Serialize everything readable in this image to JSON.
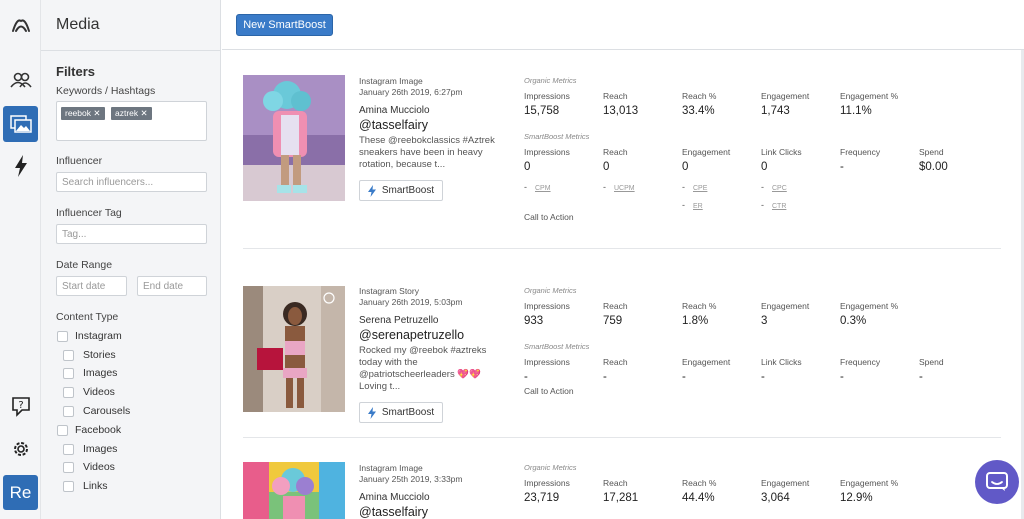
{
  "brand": {
    "logo_icon": "logo-icon",
    "accent": "#2f6db5"
  },
  "rail": {
    "items": [
      {
        "name": "influencers-icon"
      },
      {
        "name": "media-icon",
        "active": true
      },
      {
        "name": "boost-icon"
      },
      {
        "name": "help-icon"
      },
      {
        "name": "settings-icon"
      }
    ],
    "account_label": "Re"
  },
  "sidebar": {
    "title": "Media",
    "filters_heading": "Filters",
    "keywords_label": "Keywords / Hashtags",
    "tags": [
      "reebok",
      "aztrek"
    ],
    "influencer_label": "Influencer",
    "influencer_placeholder": "Search influencers...",
    "influencer_tag_label": "Influencer Tag",
    "tag_placeholder": "Tag...",
    "date_range_label": "Date Range",
    "start_placeholder": "Start date",
    "end_placeholder": "End date",
    "content_type_label": "Content Type",
    "content_types": {
      "instagram": "Instagram",
      "stories": "Stories",
      "images": "Images",
      "videos": "Videos",
      "carousels": "Carousels",
      "facebook": "Facebook",
      "fb_images": "Images",
      "fb_videos": "Videos",
      "fb_links": "Links"
    }
  },
  "toolbar": {
    "new_smartboost": "New SmartBoost"
  },
  "posts": [
    {
      "type": "Instagram Image",
      "date": "January 26th 2019, 6:27pm",
      "name": "Amina Mucciolo",
      "handle": "@tasselfairy",
      "caption": "These @reebokclassics #Aztrek sneakers have been in heavy rotation, because t...",
      "smartboost_label": "SmartBoost",
      "organic_label": "Organic Metrics",
      "organic": [
        {
          "label": "Impressions",
          "value": "15,758"
        },
        {
          "label": "Reach",
          "value": "13,013"
        },
        {
          "label": "Reach %",
          "value": "33.4%"
        },
        {
          "label": "Engagement",
          "value": "1,743"
        },
        {
          "label": "Engagement %",
          "value": "11.1%"
        }
      ],
      "smartboost_metrics_label": "SmartBoost Metrics",
      "smartboost": [
        {
          "label": "Impressions",
          "value": "0"
        },
        {
          "label": "Reach",
          "value": "0"
        },
        {
          "label": "Engagement",
          "value": "0"
        },
        {
          "label": "Link Clicks",
          "value": "0"
        },
        {
          "label": "Frequency",
          "value": "-"
        },
        {
          "label": "Spend",
          "value": "$0.00"
        }
      ],
      "subs": {
        "cpm": "CPM",
        "ucpm": "UCPM",
        "cpe": "CPE",
        "er": "ER",
        "cpc": "CPC",
        "ctr": "CTR",
        "dash": "-"
      },
      "cta": "Call to Action"
    },
    {
      "type": "Instagram Story",
      "date": "January 26th 2019, 5:03pm",
      "name": "Serena Petruzello",
      "handle": "@serenapetruzello",
      "caption": "Rocked my @reebok #aztreks today with the @patriotscheerleaders 💖💖 Loving t...",
      "smartboost_label": "SmartBoost",
      "organic_label": "Organic Metrics",
      "organic": [
        {
          "label": "Impressions",
          "value": "933"
        },
        {
          "label": "Reach",
          "value": "759"
        },
        {
          "label": "Reach %",
          "value": "1.8%"
        },
        {
          "label": "Engagement",
          "value": "3"
        },
        {
          "label": "Engagement %",
          "value": "0.3%"
        }
      ],
      "smartboost_metrics_label": "SmartBoost Metrics",
      "smartboost": [
        {
          "label": "Impressions",
          "value": "-"
        },
        {
          "label": "Reach",
          "value": "-"
        },
        {
          "label": "Engagement",
          "value": "-"
        },
        {
          "label": "Link Clicks",
          "value": "-"
        },
        {
          "label": "Frequency",
          "value": "-"
        },
        {
          "label": "Spend",
          "value": "-"
        }
      ],
      "cta": "Call to Action"
    },
    {
      "type": "Instagram Image",
      "date": "January 25th 2019, 3:33pm",
      "name": "Amina Mucciolo",
      "handle": "@tasselfairy",
      "organic_label": "Organic Metrics",
      "organic": [
        {
          "label": "Impressions",
          "value": "23,719"
        },
        {
          "label": "Reach",
          "value": "17,281"
        },
        {
          "label": "Reach %",
          "value": "44.4%"
        },
        {
          "label": "Engagement",
          "value": "3,064"
        },
        {
          "label": "Engagement %",
          "value": "12.9%"
        }
      ]
    }
  ],
  "chat": {
    "icon": "chat-icon",
    "color": "#6159c7"
  }
}
